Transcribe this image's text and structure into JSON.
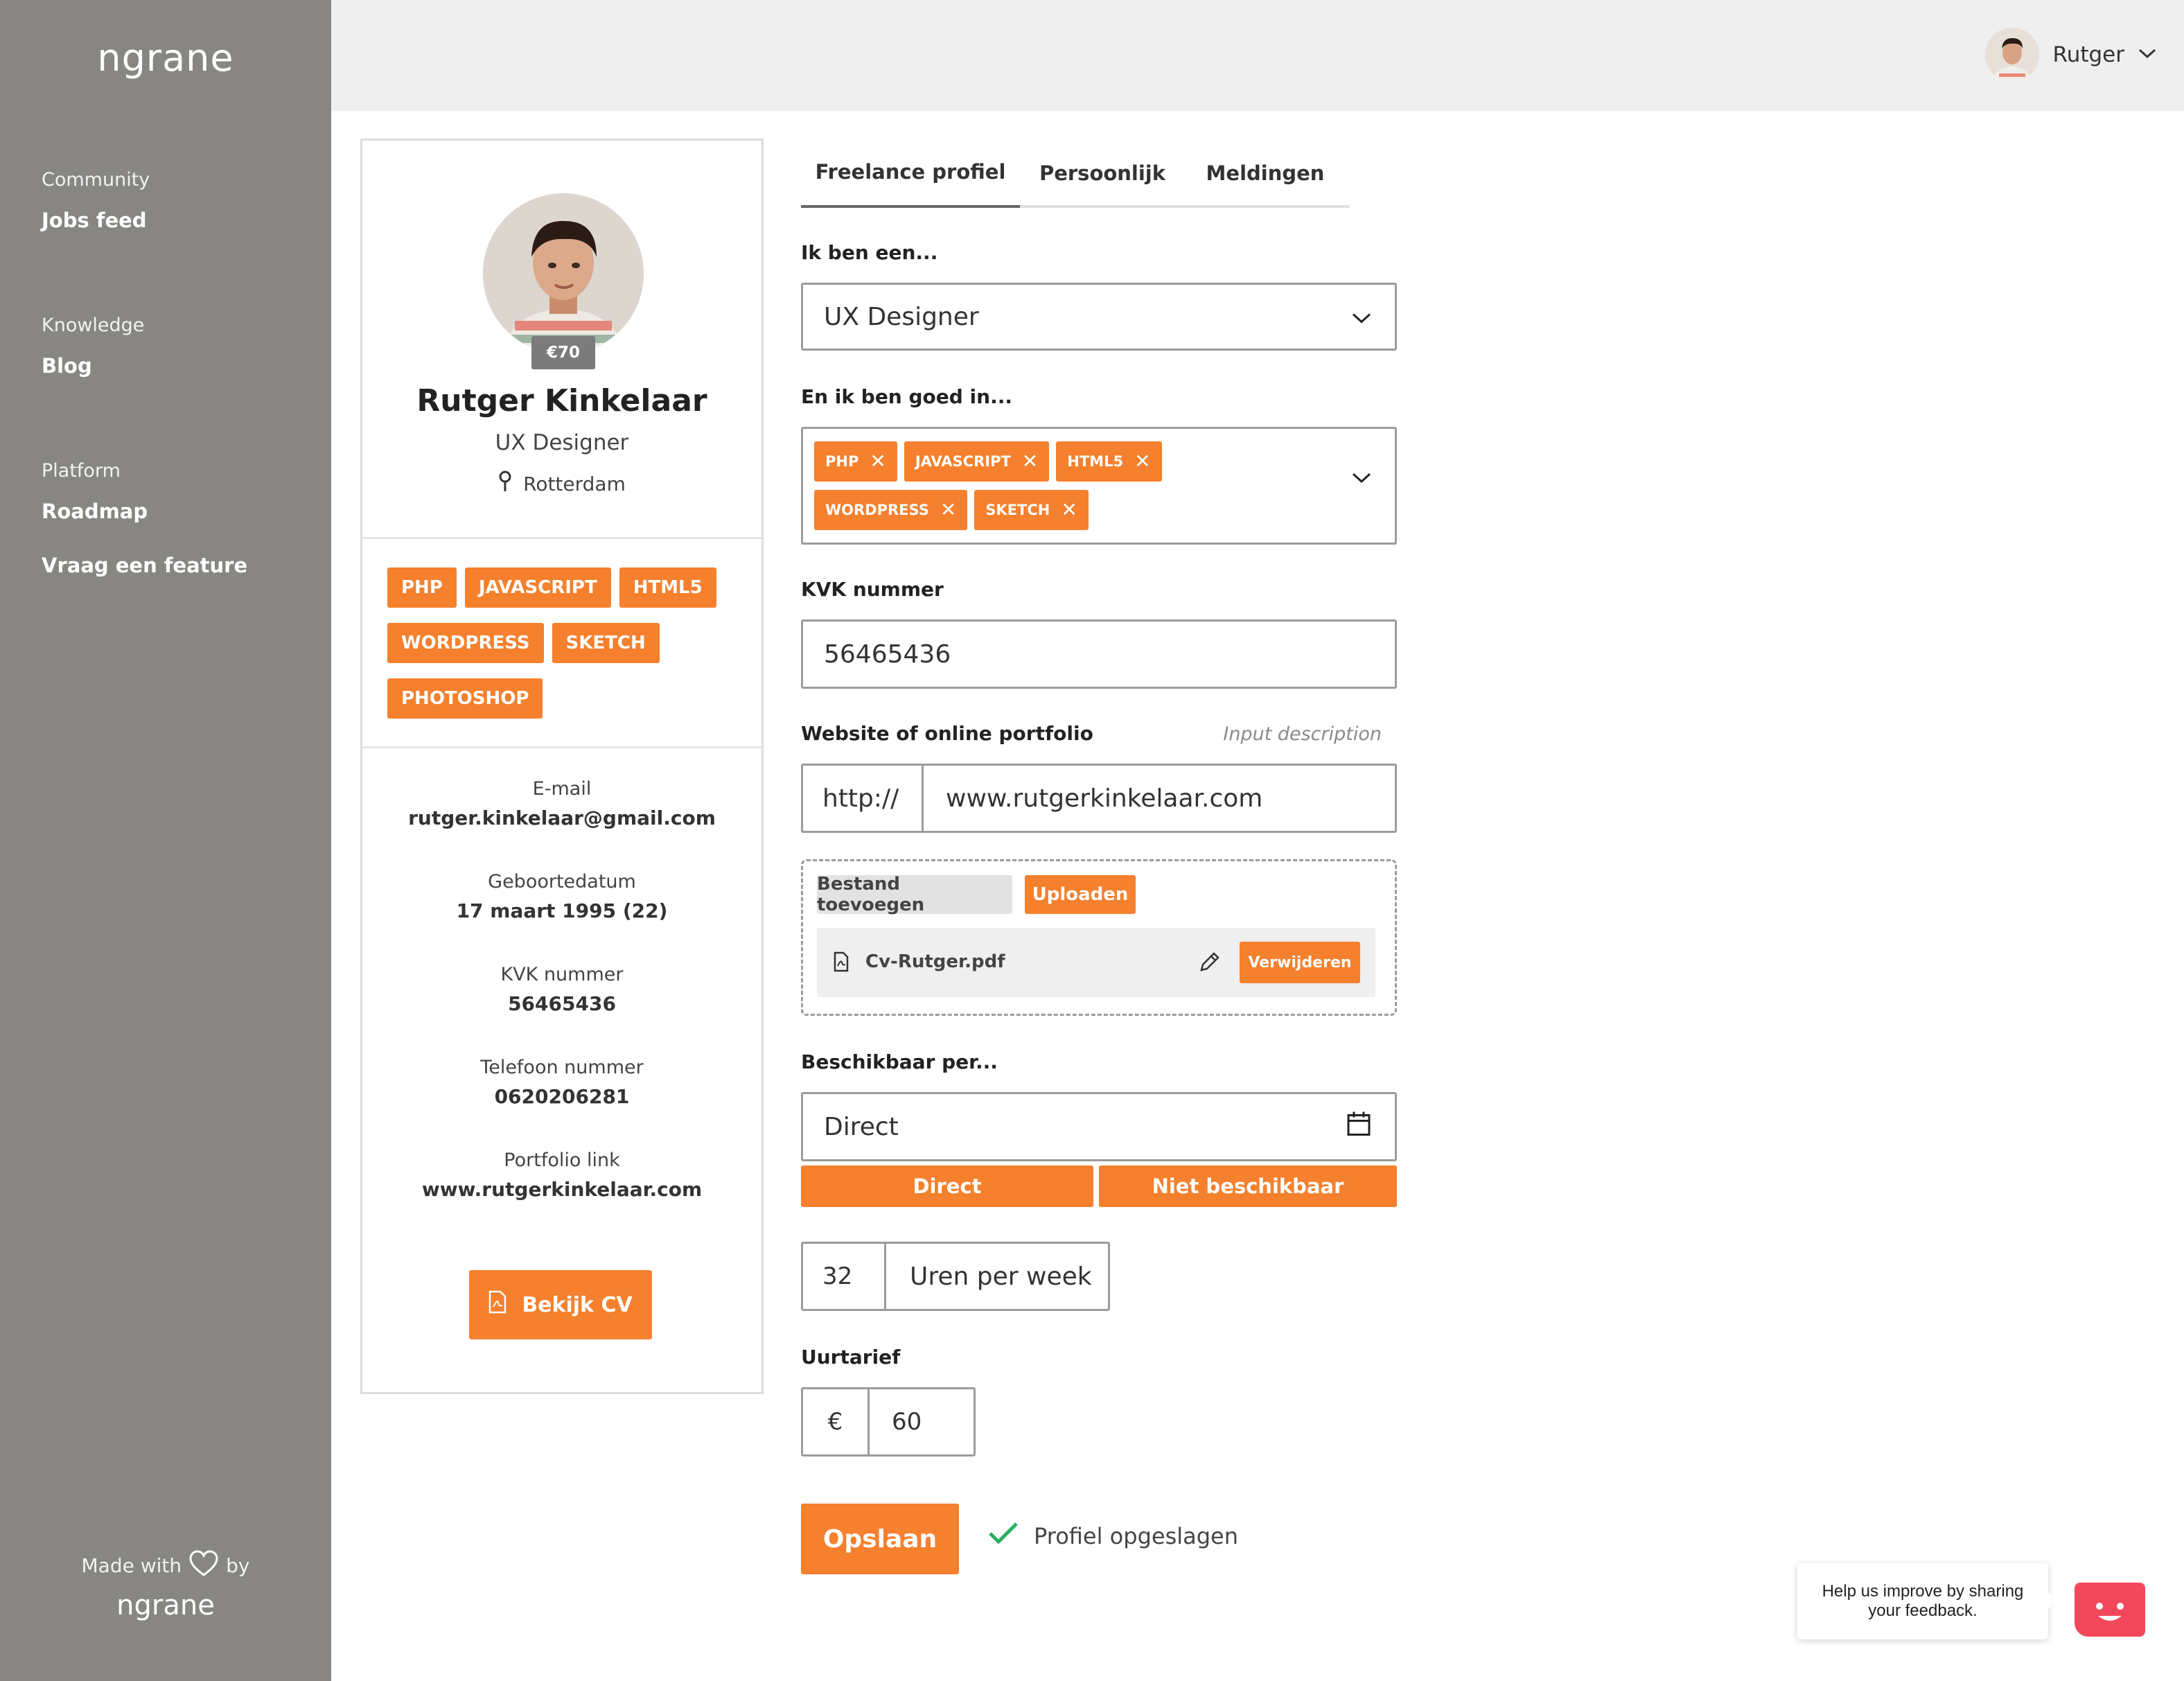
{
  "sidebar": {
    "logo": "ngrane",
    "groups": [
      {
        "category": "Community",
        "links": [
          "Jobs feed"
        ]
      },
      {
        "category": "Knowledge",
        "links": [
          "Blog"
        ]
      },
      {
        "category": "Platform",
        "links": [
          "Roadmap",
          "Vraag een feature"
        ]
      }
    ],
    "made_with": "Made with",
    "made_by": "by",
    "footer_logo": "ngrane"
  },
  "topbar": {
    "user_name": "Rutger"
  },
  "profile": {
    "rate": "€70",
    "name": "Rutger Kinkelaar",
    "role": "UX Designer",
    "location": "Rotterdam",
    "skills": [
      "PHP",
      "JAVASCRIPT",
      "HTML5",
      "WORDPRESS",
      "SKETCH",
      "PHOTOSHOP"
    ],
    "info": [
      {
        "label": "E-mail",
        "value": "rutger.kinkelaar@gmail.com"
      },
      {
        "label": "Geboortedatum",
        "value": "17 maart 1995 (22)"
      },
      {
        "label": "KVK nummer",
        "value": "56465436"
      },
      {
        "label": "Telefoon nummer",
        "value": "0620206281"
      },
      {
        "label": "Portfolio link",
        "value": "www.rutgerkinkelaar.com"
      }
    ],
    "cv_button": "Bekijk CV"
  },
  "tabs": [
    "Freelance profiel",
    "Persoonlijk",
    "Meldingen"
  ],
  "form": {
    "role_label": "Ik ben een...",
    "role_value": "UX Designer",
    "skills_label": "En ik ben goed in...",
    "skills": [
      "PHP",
      "JAVASCRIPT",
      "HTML5",
      "WORDPRESS",
      "SKETCH"
    ],
    "kvk_label": "KVK nummer",
    "kvk_value": "56465436",
    "website_label": "Website of online portfolio",
    "website_hint": "Input description",
    "website_prefix": "http://",
    "website_value": "www.rutgerkinkelaar.com",
    "add_file_button": "Bestand toevoegen",
    "upload_button": "Uploaden",
    "file_name": "Cv-Rutger.pdf",
    "remove_button": "Verwijderen",
    "available_label": "Beschikbaar per...",
    "available_value": "Direct",
    "available_options": [
      "Direct",
      "Niet beschikbaar"
    ],
    "hours_value": "32",
    "hours_unit": "Uren per week",
    "rate_label": "Uurtarief",
    "currency": "€",
    "rate_value": "60",
    "save_button": "Opslaan",
    "saved_message": "Profiel opgeslagen"
  },
  "feedback": {
    "text": "Help us improve by sharing your feedback."
  },
  "colors": {
    "accent": "#f5802d",
    "sidebar": "#878683",
    "success": "#27ae60",
    "feedback": "#f3485b"
  }
}
